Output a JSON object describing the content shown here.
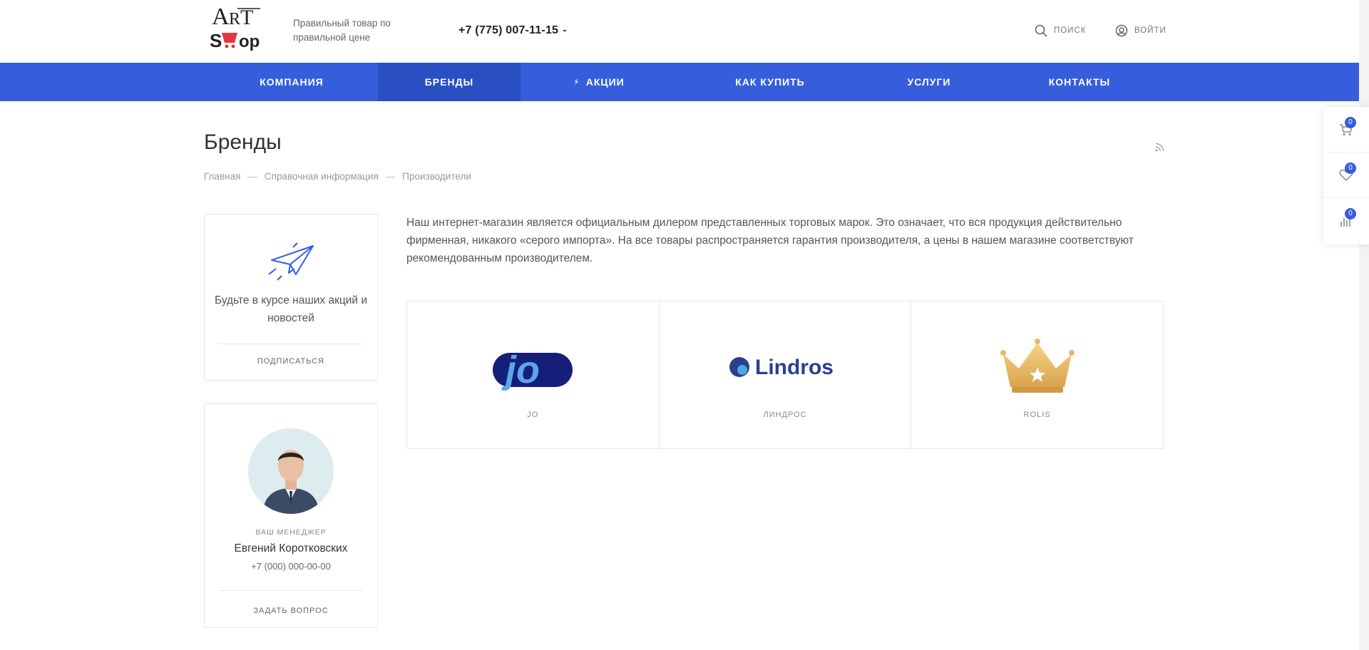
{
  "header": {
    "tagline": "Правильный товар по правильной цене",
    "phone": "+7 (775) 007-11-15",
    "search_label": "Поиск",
    "login_label": "Войти",
    "logo_text_top": "ArT",
    "logo_text_bottom": "Shop"
  },
  "nav": {
    "items": [
      {
        "label": "Компания"
      },
      {
        "label": "Бренды",
        "active": true
      },
      {
        "label": "Акции"
      },
      {
        "label": "Как купить"
      },
      {
        "label": "Услуги"
      },
      {
        "label": "Контакты"
      }
    ]
  },
  "page": {
    "title": "Бренды",
    "breadcrumb": [
      "Главная",
      "Справочная информация",
      "Производители"
    ]
  },
  "subscribe": {
    "text": "Будьте в курсе наших акций и новостей",
    "action": "Подписаться"
  },
  "manager": {
    "label": "Ваш менеджер",
    "name": "Евгений Коротковских",
    "phone": "+7 (000) 000-00-00",
    "action": "Задать вопрос"
  },
  "intro_text": "Наш интернет-магазин является официальным дилером представленных торговых марок. Это означает, что вся продукция действительно фирменная, никакого «серого импорта». На все товары распространяется гарантия производителя, а цены в нашем магазине соответствуют рекомендованным производителем.",
  "brands": [
    {
      "name": "JO",
      "logo_text": "jo"
    },
    {
      "name": "Линдрос",
      "logo_text": "Lindros"
    },
    {
      "name": "ROLIS",
      "logo_text": ""
    }
  ],
  "side_panel": {
    "cart_count": "0",
    "favorites_count": "0",
    "compare_count": "0"
  },
  "colors": {
    "accent": "#365edc",
    "nav_active": "#2a4fc3"
  }
}
